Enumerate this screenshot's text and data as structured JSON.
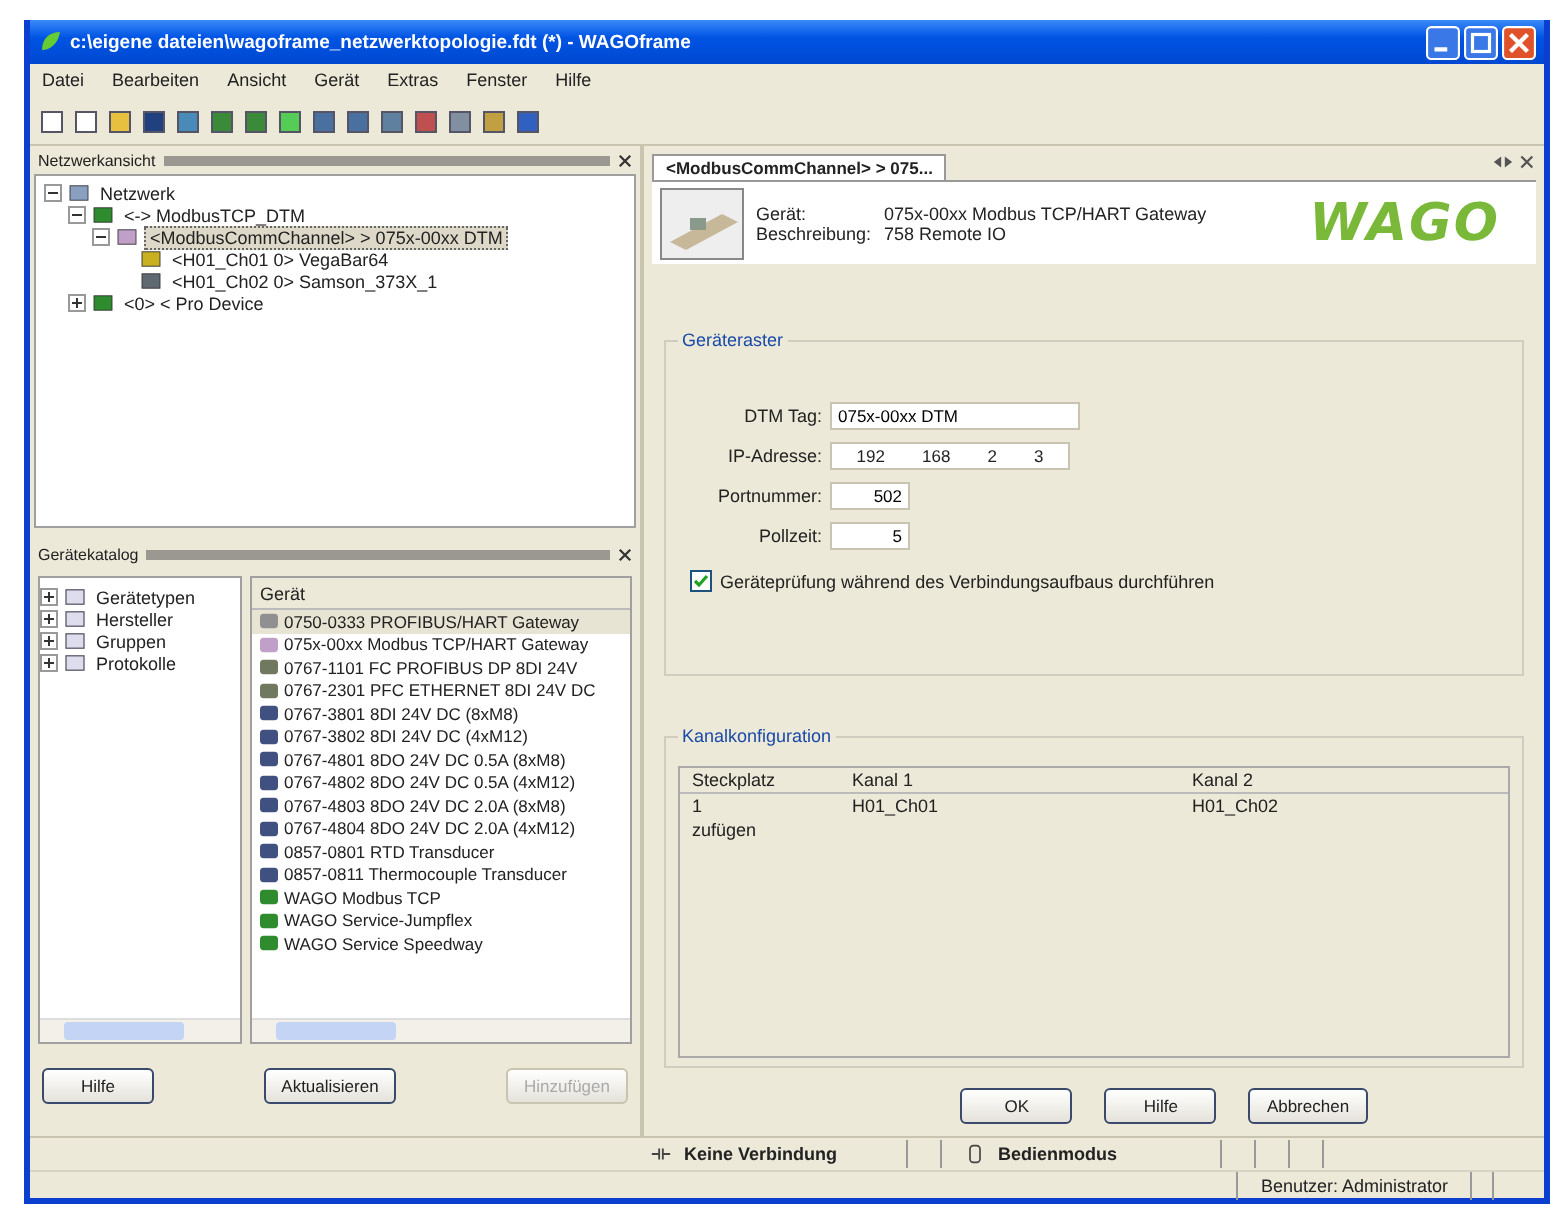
{
  "window": {
    "title": "c:\\eigene dateien\\wagoframe_netzwerktopologie.fdt (*) - WAGOframe"
  },
  "menu": [
    "Datei",
    "Bearbeiten",
    "Ansicht",
    "Gerät",
    "Extras",
    "Fenster",
    "Hilfe"
  ],
  "network_panel": {
    "title": "Netzwerkansicht",
    "tree": [
      {
        "label": "Netzwerk",
        "kind": "network",
        "expanded": true,
        "selected": false,
        "children": [
          {
            "label": "<-> ModbusTCP_DTM",
            "kind": "green",
            "expanded": true,
            "selected": false,
            "children": [
              {
                "label": "<ModbusCommChannel> > 075x-00xx DTM",
                "kind": "gateway",
                "expanded": true,
                "selected": true,
                "children": [
                  {
                    "label": "<H01_Ch01 0> VegaBar64",
                    "kind": "sensor",
                    "selected": false
                  },
                  {
                    "label": "<H01_Ch02 0> Samson_373X_1",
                    "kind": "valve",
                    "selected": false
                  }
                ]
              }
            ]
          },
          {
            "label": "<0> < Pro Device",
            "kind": "green",
            "expanded": false,
            "selected": false
          }
        ]
      }
    ]
  },
  "catalog_panel": {
    "title": "Gerätekatalog",
    "tree": [
      {
        "label": "Gerätetypen"
      },
      {
        "label": "Hersteller"
      },
      {
        "label": "Gruppen"
      },
      {
        "label": "Protokolle"
      }
    ],
    "column": "Gerät",
    "items": [
      {
        "label": "0750-0333 PROFIBUS/HART Gateway",
        "kind": "hart",
        "selected": true
      },
      {
        "label": "075x-00xx Modbus TCP/HART Gateway",
        "kind": "gateway",
        "selected": false
      },
      {
        "label": "0767-1101 FC PROFIBUS DP 8DI 24V",
        "kind": "plc",
        "selected": false
      },
      {
        "label": "0767-2301 PFC ETHERNET 8DI 24V DC",
        "kind": "plc",
        "selected": false
      },
      {
        "label": "0767-3801 8DI 24V DC (8xM8)",
        "kind": "io",
        "selected": false
      },
      {
        "label": "0767-3802 8DI 24V DC (4xM12)",
        "kind": "io",
        "selected": false
      },
      {
        "label": "0767-4801 8DO 24V DC 0.5A (8xM8)",
        "kind": "io",
        "selected": false
      },
      {
        "label": "0767-4802 8DO 24V DC 0.5A (4xM12)",
        "kind": "io",
        "selected": false
      },
      {
        "label": "0767-4803 8DO 24V DC 2.0A (8xM8)",
        "kind": "io",
        "selected": false
      },
      {
        "label": "0767-4804 8DO 24V DC 2.0A (4xM12)",
        "kind": "io",
        "selected": false
      },
      {
        "label": "0857-0801 RTD Transducer",
        "kind": "io",
        "selected": false
      },
      {
        "label": "0857-0811 Thermocouple Transducer",
        "kind": "io",
        "selected": false
      },
      {
        "label": "WAGO Modbus TCP",
        "kind": "green",
        "selected": false
      },
      {
        "label": "WAGO Service-Jumpflex",
        "kind": "green",
        "selected": false
      },
      {
        "label": "WAGO Service Speedway",
        "kind": "green",
        "selected": false
      }
    ],
    "buttons": [
      {
        "label": "Hilfe",
        "disabled": false
      },
      {
        "label": "Aktualisieren",
        "disabled": false
      },
      {
        "label": "Hinzufügen",
        "disabled": true
      }
    ]
  },
  "editor": {
    "tab": "<ModbusCommChannel> > 075...",
    "device_label": "Gerät:",
    "device": "075x-00xx Modbus TCP/HART Gateway",
    "description_label": "Beschreibung:",
    "description": "758 Remote IO",
    "logo": "WAGO",
    "parameters": {
      "title": "Geräteraster",
      "dtm_tag_label": "DTM Tag:",
      "dtm_tag": "075x-00xx DTM",
      "ip_label": "IP-Adresse:",
      "ip": [
        "192",
        "168",
        "2",
        "3"
      ],
      "port_label": "Portnummer:",
      "port": "502",
      "poll_label": "Pollzeit:",
      "poll": "5",
      "check": {
        "label": "Geräteprüfung während des Verbindungsaufbaus durchführen",
        "checked": true
      }
    },
    "channels": {
      "title": "Kanalkonfiguration",
      "columns": [
        "Steckplatz",
        "Kanal 1",
        "Kanal 2"
      ],
      "rows": [
        [
          "1",
          "H01_Ch01",
          "H01_Ch02"
        ],
        [
          "zufügen",
          "",
          ""
        ]
      ]
    },
    "buttons": [
      "OK",
      "Hilfe",
      "Abbrechen"
    ]
  },
  "status_bar": {
    "connection": "Keine Verbindung",
    "mode": "Bedienmodus",
    "user": "Benutzer: Administrator"
  }
}
